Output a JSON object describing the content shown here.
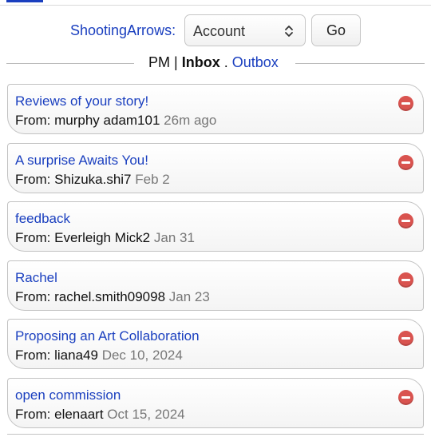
{
  "account_bar": {
    "username": "ShootingArrows",
    "username_suffix": ":",
    "select_value": "Account",
    "go_label": "Go"
  },
  "pm_heading": {
    "pm_label": "PM",
    "separator": "|",
    "inbox_label": "Inbox",
    "dot": ".",
    "outbox_label": "Outbox"
  },
  "messages": [
    {
      "subject": "Reviews of your story!",
      "from_prefix": "From:",
      "sender": "murphy adam101",
      "date": "26m ago"
    },
    {
      "subject": "A surprise Awaits You!",
      "from_prefix": "From:",
      "sender": "Shizuka.shi7",
      "date": "Feb 2"
    },
    {
      "subject": "feedback",
      "from_prefix": "From:",
      "sender": "Everleigh Mick2",
      "date": "Jan 31"
    },
    {
      "subject": "Rachel",
      "from_prefix": "From:",
      "sender": "rachel.smith09098",
      "date": "Jan 23"
    },
    {
      "subject": "Proposing an Art Collaboration",
      "from_prefix": "From:",
      "sender": "liana49",
      "date": "Dec 10, 2024"
    },
    {
      "subject": "open commission",
      "from_prefix": "From:",
      "sender": "elenaart",
      "date": "Oct 15, 2024"
    }
  ],
  "icons": {
    "delete": "delete-icon",
    "select_chevron": "chevron-up-down-icon"
  },
  "colors": {
    "link": "#1a3fbf",
    "delete": "#d9534f",
    "date": "#777777"
  }
}
